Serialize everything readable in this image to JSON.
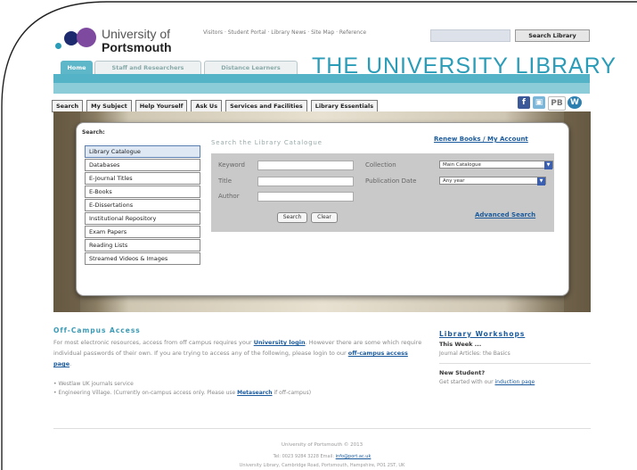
{
  "colors": {
    "accent": "#2a9cb8",
    "teal_bar": "#55b3c7",
    "link": "#1a5a9c"
  },
  "logo": {
    "line1": "University of",
    "line2": "Portsmouth"
  },
  "top_links": "Visitors · Student Portal · Library News · Site Map · Reference",
  "search": {
    "button": "Search Library",
    "placeholder": ""
  },
  "tabs": [
    {
      "label": "Home",
      "active": true
    },
    {
      "label": "Staff and Researchers",
      "active": false
    },
    {
      "label": "Distance Learners",
      "active": false
    }
  ],
  "site_title": "THE UNIVERSITY LIBRARY",
  "nav": [
    "Search",
    "My Subject",
    "Help Yourself",
    "Ask Us",
    "Services and Facilities",
    "Library Essentials"
  ],
  "social_icons": [
    "facebook-icon",
    "blog-icon",
    "pb-icon",
    "wordpress-icon"
  ],
  "panel": {
    "label": "Search:",
    "side_items": [
      "Library Catalogue",
      "Databases",
      "E-Journal Titles",
      "E-Books",
      "E-Dissertations",
      "Institutional Repository",
      "Exam Papers",
      "Reading Lists",
      "Streamed Videos & Images"
    ],
    "search_title": "Search the Library Catalogue",
    "renew_link": "Renew Books / My Account",
    "fields": {
      "keyword": "Keyword",
      "title": "Title",
      "author": "Author",
      "collection": "Collection",
      "publication_date": "Publication Date"
    },
    "collection_value": "Main Catalogue",
    "date_value": "Any year",
    "search_button": "Search",
    "clear_button": "Clear",
    "advanced_link": "Advanced Search"
  },
  "off_campus": {
    "title": "Off-Campus Access",
    "text1": "For most electronic resources, access from off campus requires your",
    "link1": "University login",
    "text2": "However there are some which require individual passwords of their own. If you are trying to access any of the following, please login to our",
    "link2": "off-campus access page",
    "bullet1": "Westlaw UK journals service",
    "bullet2_pre": "Engineering Village. (Currently on-campus access only. Please use",
    "bullet2_link": "Metasearch",
    "bullet2_post": "if off-campus)"
  },
  "workshops": {
    "title": "Library Workshops",
    "this_week": "This Week ...",
    "item": "Journal Articles: the Basics",
    "new_student": "New Student?",
    "new_text": "Get started with our",
    "induction_link": "induction page"
  },
  "footer": {
    "line1": "University of Portsmouth © 2013",
    "line2_pre": "Tel: 0023 9284 3228 Email:",
    "line2_link": "info@port.ac.uk",
    "line3": "University Library, Cambridge Road, Portsmouth, Hampshire, PO1 2ST, UK"
  }
}
